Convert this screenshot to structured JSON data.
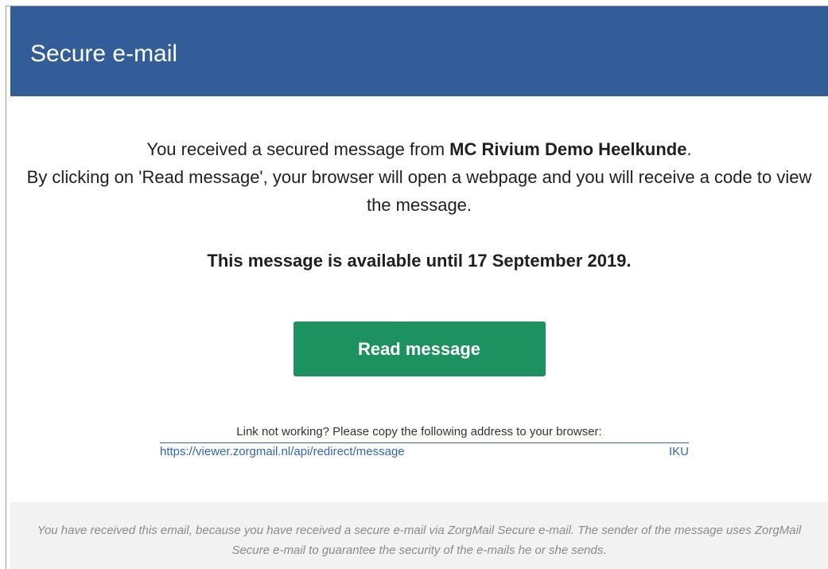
{
  "header": {
    "title": "Secure e-mail"
  },
  "main": {
    "intro_prefix": "You received a secured message from ",
    "sender": "MC Rivium Demo Heelkunde",
    "intro_suffix": ".",
    "intro_line2": "By clicking on 'Read message', your browser will open a webpage and you will receive a code to view the message.",
    "availability": "This message is available until 17 September 2019.",
    "read_button": "Read message",
    "fallback_text": "Link not working? Please copy the following address to your browser:",
    "fallback_link_start": "https://viewer.zorgmail.nl/api/redirect/message",
    "fallback_link_end": "IKU"
  },
  "footer": {
    "text": "You have received this email, because you have received a secure e-mail via ZorgMail Secure e-mail. The sender of the message uses ZorgMail Secure e-mail to guarantee the security of the e-mails he or she sends."
  },
  "colors": {
    "header_bg": "#335d99",
    "button_bg": "#1e9160",
    "link": "#3366aa",
    "footer_bg": "#f2f2f2"
  }
}
